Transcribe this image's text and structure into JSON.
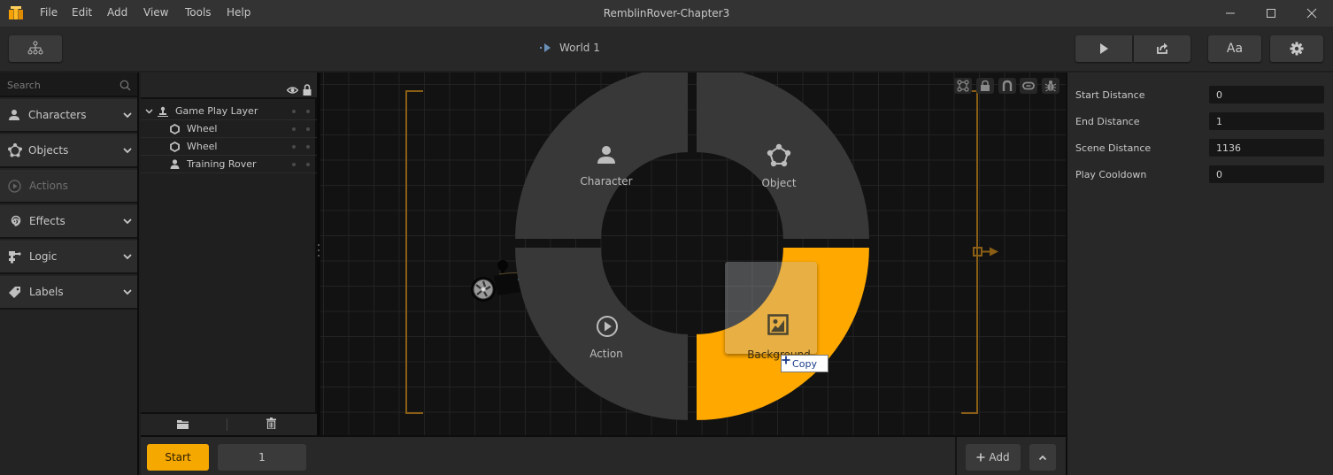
{
  "app": {
    "title": "RemblinRover-Chapter3",
    "menu": [
      "File",
      "Edit",
      "Add",
      "View",
      "Tools",
      "Help"
    ],
    "window_controls": [
      "minimize",
      "maximize",
      "close"
    ]
  },
  "toolbar": {
    "hierarchy_icon": "hierarchy-icon",
    "breadcrumb": "World 1",
    "play_icon": "play-icon",
    "export_icon": "share-export-icon",
    "font_label": "Aa",
    "settings_icon": "gear-icon"
  },
  "sidebar": {
    "search_placeholder": "Search",
    "categories": [
      {
        "label": "Characters",
        "icon": "person-icon",
        "enabled": true
      },
      {
        "label": "Objects",
        "icon": "pentagon-nodes-icon",
        "enabled": true
      },
      {
        "label": "Actions",
        "icon": "play-circle-icon",
        "enabled": false
      },
      {
        "label": "Effects",
        "icon": "spiral-icon",
        "enabled": true
      },
      {
        "label": "Logic",
        "icon": "logic-blocks-icon",
        "enabled": true
      },
      {
        "label": "Labels",
        "icon": "tag-icon",
        "enabled": true
      }
    ]
  },
  "layers": {
    "header_icons": [
      "eye-icon",
      "lock-icon"
    ],
    "rows": [
      {
        "label": "Game Play Layer",
        "icon": "layer-icon",
        "expanded": true,
        "depth": 0
      },
      {
        "label": "Wheel",
        "icon": "hexagon-icon",
        "depth": 1
      },
      {
        "label": "Wheel",
        "icon": "hexagon-icon",
        "depth": 1
      },
      {
        "label": "Training Rover",
        "icon": "person-icon",
        "depth": 1
      }
    ],
    "footer_icons": [
      "folder-icon",
      "trash-icon"
    ]
  },
  "canvas": {
    "tools": [
      "group-nodes-icon",
      "lock-icon",
      "magnet-icon",
      "link-icon",
      "bug-icon"
    ],
    "radial_menu": {
      "items": [
        {
          "label": "Character",
          "icon": "person-icon",
          "active": false
        },
        {
          "label": "Object",
          "icon": "pentagon-nodes-icon",
          "active": false
        },
        {
          "label": "Action",
          "icon": "play-circle-icon",
          "active": false
        },
        {
          "label": "Background",
          "icon": "image-icon",
          "active": true
        }
      ],
      "active_color": "#FFA800"
    },
    "drag_tooltip": "Copy",
    "bracket_color": "#8a5e14"
  },
  "bottom": {
    "start_label": "Start",
    "page_value": "1",
    "add_label": "Add"
  },
  "properties": [
    {
      "label": "Start Distance",
      "value": "0"
    },
    {
      "label": "End Distance",
      "value": "1"
    },
    {
      "label": "Scene Distance",
      "value": "1136"
    },
    {
      "label": "Play Cooldown",
      "value": "0"
    }
  ]
}
